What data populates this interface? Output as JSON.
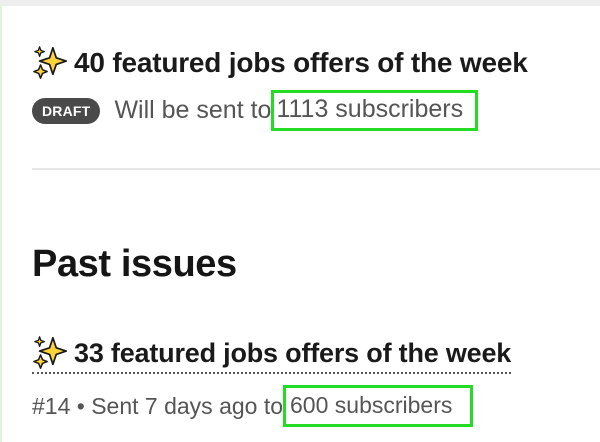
{
  "draft_issue": {
    "title": "40 featured jobs offers of the week",
    "badge": "DRAFT",
    "status_prefix": "Will be sent to ",
    "subscribers": "1113 subscribers"
  },
  "past_issues": {
    "heading": "Past issues",
    "items": [
      {
        "title": "33 featured jobs offers of the week",
        "meta_prefix": "#14 • Sent 7 days ago to ",
        "subscribers": "600 subscribers"
      }
    ]
  },
  "icons": {
    "title_icon": "sparkles-icon"
  },
  "colors": {
    "highlight": "#25dc25",
    "badge_bg": "#4a4a4a",
    "sparkle": "#ffd43b"
  }
}
